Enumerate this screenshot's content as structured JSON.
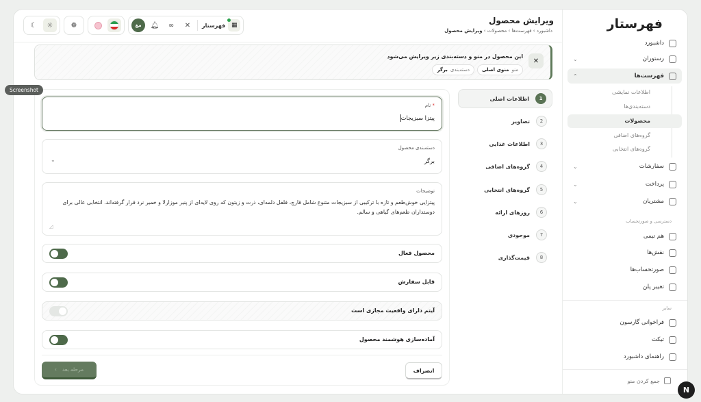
{
  "sidebar": {
    "logo": "فهرستار",
    "items": [
      {
        "label": "داشبورد",
        "icon": "dashboard-icon"
      },
      {
        "label": "رستوران",
        "icon": "store-icon"
      },
      {
        "label": "فهرست‌ها",
        "icon": "utensils-icon"
      },
      {
        "label": "سفارشات",
        "icon": "orders-icon"
      },
      {
        "label": "پرداخت",
        "icon": "tag-icon"
      },
      {
        "label": "مشتریان",
        "icon": "customers-icon"
      },
      {
        "label": "هم تیمی",
        "icon": "team-icon"
      },
      {
        "label": "نقش‌ها",
        "icon": "shield-icon"
      },
      {
        "label": "صورتحساب‌ها",
        "icon": "invoice-icon"
      },
      {
        "label": "تغییر پلن",
        "icon": "crown-icon"
      },
      {
        "label": "فراخوانی گارسون",
        "icon": "bell-icon"
      },
      {
        "label": "تیکت",
        "icon": "ticket-icon"
      },
      {
        "label": "راهنمای داشبورد",
        "icon": "help-icon"
      }
    ],
    "sub_items": [
      "اطلاعات نمایشی",
      "دسته‌بندی‌ها",
      "محصولات",
      "گروه‌های اضافی",
      "گروه‌های انتخابی"
    ],
    "section_access": "دسترسی و صورتحساب",
    "section_other": "سایر",
    "collapse_label": "جمع کردن منو"
  },
  "header": {
    "title": "ویرایش محصول",
    "breadcrumb": [
      "داشبورد",
      "فهرست‌ها",
      "محصولات",
      "ویرایش محصول"
    ],
    "shop_name": "فهرستار",
    "avatar_text": "مغ"
  },
  "banner": {
    "title": "این محصول در منو و دسته‌بندی زیر ویرایش می‌شود",
    "menu_key": "منو",
    "menu_value": "منوی اصلی",
    "category_key": "دسته‌بندی",
    "category_value": "برگر"
  },
  "steps": [
    {
      "num": "1",
      "label": "اطلاعات اصلی"
    },
    {
      "num": "2",
      "label": "تصاویر"
    },
    {
      "num": "3",
      "label": "اطلاعات غذایی"
    },
    {
      "num": "4",
      "label": "گروه‌های اضافی"
    },
    {
      "num": "5",
      "label": "گروه‌های انتخابی"
    },
    {
      "num": "6",
      "label": "روزهای ارائه"
    },
    {
      "num": "7",
      "label": "موجودی"
    },
    {
      "num": "8",
      "label": "قیمت‌گذاری"
    }
  ],
  "form": {
    "name_label": "نام",
    "name_required": "*",
    "name_value": "پیتزا سبزیجات",
    "category_label": "دسته‌بندی محصول",
    "category_value": "برگر",
    "desc_label": "توضیحات",
    "desc_value": "پیتزایی خوش‌طعم و تازه با ترکیبی از سبزیجات متنوع شامل قارچ، فلفل دلمه‌ای، ذرت و زیتون که روی لایه‌ای از پنیر موزارلا و خمیر نرد قرار گرفته‌اند. انتخابی عالی برای دوستداران طعم‌های گیاهی و سالم.",
    "toggles": [
      {
        "label": "محصول فعال",
        "on": true
      },
      {
        "label": "قابل سفارش",
        "on": true
      },
      {
        "label": "آیتم دارای واقعیت مجازی است",
        "on": false
      },
      {
        "label": "آماده‌سازی هوشمند محصول",
        "on": true
      }
    ],
    "cancel_label": "انصراف",
    "next_label": "مرحله بعد"
  },
  "overlay": {
    "screenshot_tag": "Screenshot",
    "fab_letter": "N"
  },
  "colors": {
    "accent": "#4e6a4a",
    "active_bg": "#eff1ef"
  }
}
